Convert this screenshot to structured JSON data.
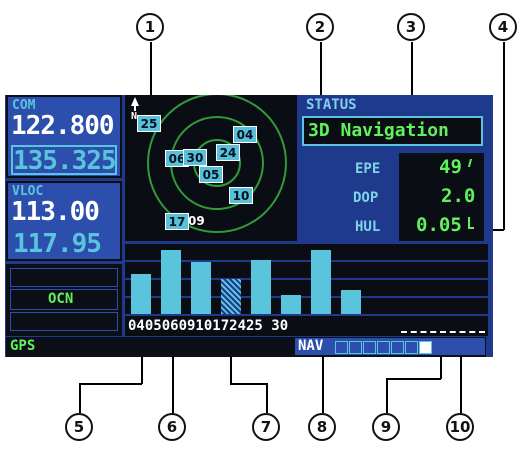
{
  "callouts": [
    "1",
    "2",
    "3",
    "4",
    "5",
    "6",
    "7",
    "8",
    "9",
    "10"
  ],
  "com": {
    "label": "COM",
    "active": "122.800",
    "standby": "135.325"
  },
  "vloc": {
    "label": "VLOC",
    "active": "113.00",
    "standby": "117.95"
  },
  "cdi_mode": "OCN",
  "nav_source": "GPS",
  "sky": {
    "north_label": "N",
    "satellites": [
      "25",
      "04",
      "06",
      "30",
      "24",
      "05",
      "10",
      "17",
      "09"
    ]
  },
  "status": {
    "title": "STATUS",
    "mode": "3D Navigation",
    "epe_label": "EPE",
    "epe_value": "49",
    "dop_label": "DOP",
    "dop_value": "2.0",
    "hul_label": "HUL",
    "hul_value": "0.05"
  },
  "signal": {
    "satellite_labels": "0405060910172425 30",
    "bar_strengths": [
      0.62,
      1.0,
      0.82,
      0.55,
      0.85,
      0.3,
      1.0,
      0.38
    ]
  },
  "page_group": {
    "label": "NAV",
    "page_count": 7,
    "active_index": 6
  },
  "colors": {
    "screen_bg": "#1f3a8c",
    "panel_bg": "#2c4fae",
    "cyan": "#59c4db",
    "green": "#5ff25a",
    "white": "#ffffff"
  }
}
